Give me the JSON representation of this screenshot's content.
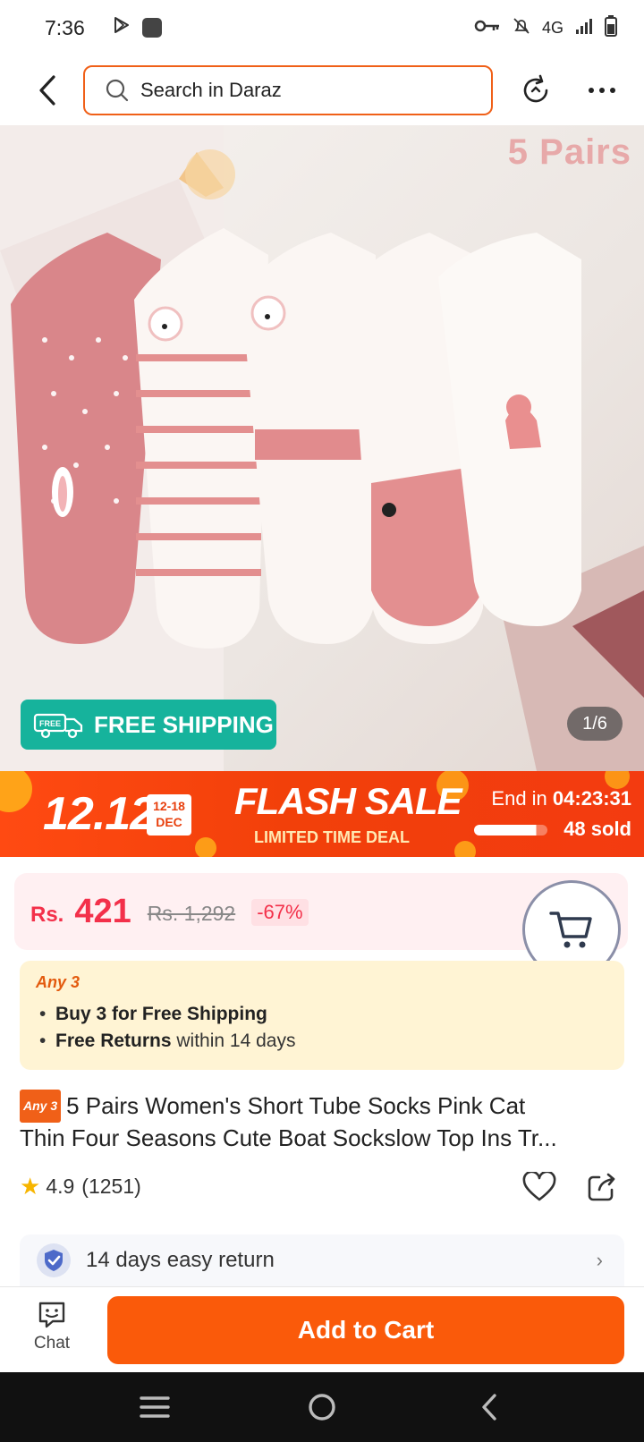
{
  "status_bar": {
    "time": "7:36",
    "network": "4G"
  },
  "header": {
    "search_placeholder": "Search in Daraz"
  },
  "hero": {
    "pairs_label": "5 Pairs",
    "free_shipping_badge": "FREE",
    "free_shipping_label": "FREE SHIPPING",
    "page_indicator": "1/6"
  },
  "flash_sale": {
    "campaign": "12.12",
    "date_range": "12-18",
    "month": "DEC",
    "title": "FLASH SALE",
    "subtitle": "LIMITED TIME DEAL",
    "end_label": "End in",
    "countdown": "04:23:31",
    "sold": "48 sold",
    "sold_progress": 0.85
  },
  "price": {
    "currency": "Rs.",
    "value": "421",
    "original": "Rs. 1,292",
    "discount": "-67%"
  },
  "promo": {
    "tag": "Any 3",
    "line1_bold": "Buy 3 for  Free Shipping",
    "line2_bold": "Free Returns",
    "line2_rest": " within 14 days"
  },
  "product": {
    "tag": "Any 3",
    "title_line1": "5 Pairs Women's Short Tube Socks Pink Cat",
    "title_line2": "Thin Four Seasons Cute Boat Sockslow Top Ins Tr..."
  },
  "rating": {
    "score": "4.9",
    "count": "(1251)"
  },
  "service": {
    "return_label": "14 days easy return"
  },
  "actions": {
    "chat_label": "Chat",
    "add_to_cart_label": "Add to Cart"
  },
  "colors": {
    "accent": "#fa5a0a",
    "price_red": "#f3304a",
    "free_ship_green": "#16b39c",
    "star": "#f7b500"
  }
}
